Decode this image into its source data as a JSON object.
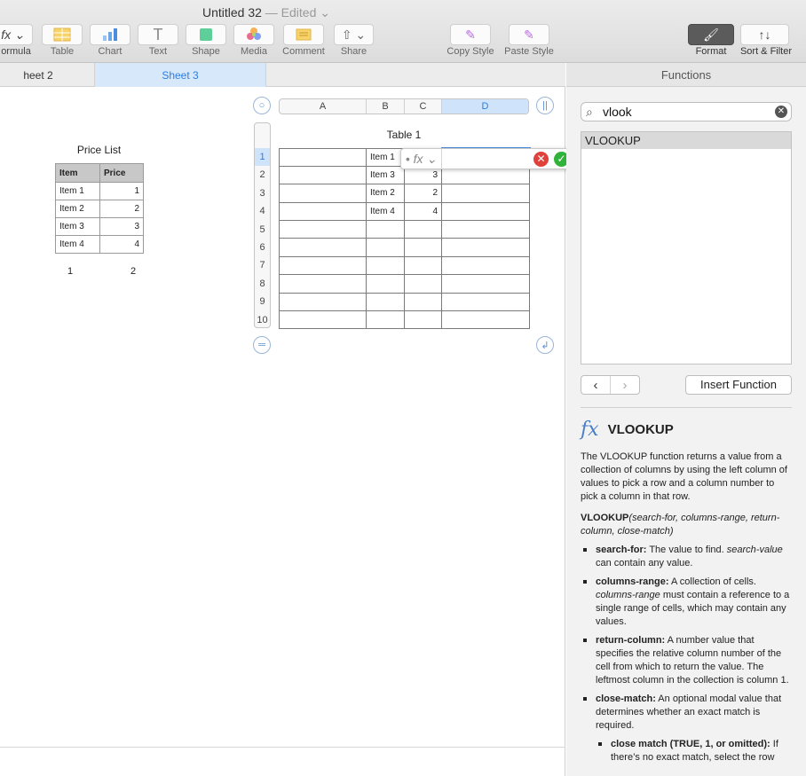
{
  "window": {
    "title": "Untitled 32",
    "edited": "— Edited ⌄"
  },
  "toolbar": {
    "formula": {
      "icon": "fx ⌄",
      "label": "ormula"
    },
    "table": "Table",
    "chart": "Chart",
    "text": "Text",
    "shape": "Shape",
    "media": "Media",
    "comment": "Comment",
    "share": "Share",
    "copy_style": "Copy Style",
    "paste_style": "Paste Style",
    "format": "Format",
    "sort_filter": "Sort & Filter"
  },
  "sheets": {
    "tab1": "heet 2",
    "tab2": "Sheet 3"
  },
  "price_list": {
    "title": "Price List",
    "headers": [
      "Item",
      "Price"
    ],
    "rows": [
      [
        "Item 1",
        "1"
      ],
      [
        "Item 2",
        "2"
      ],
      [
        "Item 3",
        "3"
      ],
      [
        "Item 4",
        "4"
      ]
    ],
    "footer": [
      "1",
      "2"
    ]
  },
  "table1": {
    "title": "Table 1",
    "columns": [
      "A",
      "B",
      "C",
      "D"
    ],
    "row_numbers": [
      "1",
      "2",
      "3",
      "4",
      "5",
      "6",
      "7",
      "8",
      "9",
      "10"
    ],
    "cells": [
      [
        "",
        "Item 1",
        "",
        ""
      ],
      [
        "",
        "Item 3",
        "3",
        ""
      ],
      [
        "",
        "Item 2",
        "2",
        ""
      ],
      [
        "",
        "Item 4",
        "4",
        ""
      ]
    ],
    "top_right_control": "||",
    "bottom_left_control": "═",
    "bottom_right_control": "↲"
  },
  "formula_editor": {
    "fx_label": "• fx ⌄",
    "cancel": "✕",
    "accept": "✓"
  },
  "functions_panel": {
    "header": "Functions",
    "search_value": "vlook",
    "results": [
      "VLOOKUP"
    ],
    "insert_button": "Insert Function",
    "nav_back": "‹",
    "nav_forward": "›",
    "doc": {
      "fx_glyph": "fx",
      "name": "VLOOKUP",
      "description": "The VLOOKUP function returns a value from a collection of columns by using the left column of values to pick a row and a column number to pick a column in that row.",
      "syntax_name": "VLOOKUP",
      "syntax_args": "(search-for, columns-range, return-column, close-match)",
      "args": [
        {
          "term": "search-for:",
          "text": " The value to find. ",
          "em": "search-value",
          "text2": " can contain any value."
        },
        {
          "term": "columns-range:",
          "text": " A collection of cells. ",
          "em": "columns-range",
          "text2": " must contain a reference to a single range of cells, which may contain any values."
        },
        {
          "term": "return-column:",
          "text": " A number value that specifies the relative column number of the cell from which to return the value. The leftmost column in the collection is column 1.",
          "em": "",
          "text2": ""
        },
        {
          "term": "close-match:",
          "text": " An optional modal value that determines whether an exact match is required.",
          "em": "",
          "text2": ""
        }
      ],
      "sub_arg": {
        "term": "close match (TRUE, 1, or omitted):",
        "text": " If there’s no exact match, select the row"
      }
    }
  },
  "colors": {
    "accent": "#4a90e2",
    "tab_active_bg": "#d7e8fb",
    "cancel_red": "#e0413a",
    "accept_green": "#2fb33b"
  }
}
